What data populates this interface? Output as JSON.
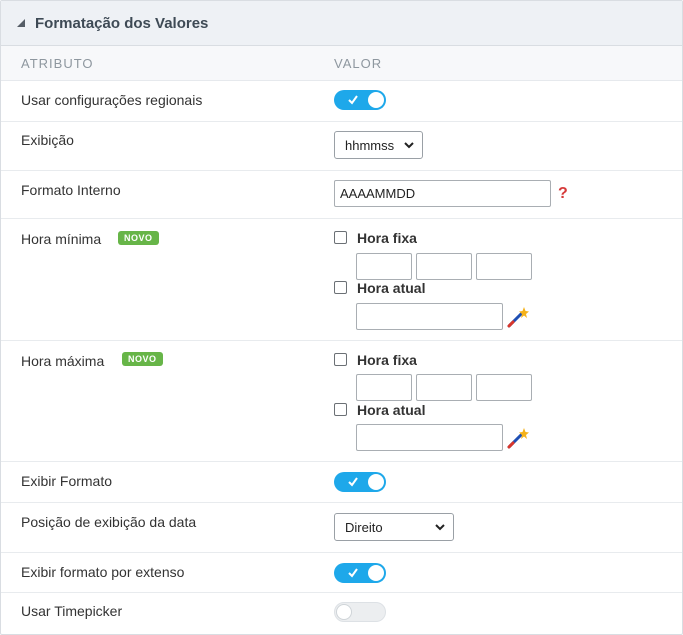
{
  "panel": {
    "title": "Formatação dos Valores",
    "collapse_icon": "triangle-collapse-icon"
  },
  "columns": {
    "attribute": "ATRIBUTO",
    "value": "VALOR"
  },
  "rows": {
    "regional": {
      "label": "Usar configurações regionais",
      "toggle": "on"
    },
    "exibicao": {
      "label": "Exibição",
      "select_value": "hhmmss"
    },
    "formato_interno": {
      "label": "Formato Interno",
      "input_value": "AAAAMMDD",
      "help_icon": "question-mark-icon"
    },
    "hora_minima": {
      "label": "Hora mínima",
      "badge": "NOVO",
      "fixed_label": "Hora fixa",
      "fixed_checked": false,
      "fixed_fields": [
        "",
        "",
        ""
      ],
      "current_label": "Hora atual",
      "current_checked": false,
      "current_value": "",
      "wand_icon": "magic-wand-icon"
    },
    "hora_maxima": {
      "label": "Hora máxima",
      "badge": "NOVO",
      "fixed_label": "Hora fixa",
      "fixed_checked": false,
      "fixed_fields": [
        "",
        "",
        ""
      ],
      "current_label": "Hora atual",
      "current_checked": false,
      "current_value": "",
      "wand_icon": "magic-wand-icon"
    },
    "exibir_formato": {
      "label": "Exibir Formato",
      "toggle": "on"
    },
    "posicao": {
      "label": "Posição de exibição da data",
      "select_value": "Direito"
    },
    "por_extenso": {
      "label": "Exibir formato por extenso",
      "toggle": "on"
    },
    "timepicker": {
      "label": "Usar Timepicker",
      "toggle": "off"
    }
  },
  "colors": {
    "toggle_on": "#1ea8ea",
    "badge": "#67b548",
    "help": "#d63a3a",
    "header_bg": "#eef1f5"
  }
}
